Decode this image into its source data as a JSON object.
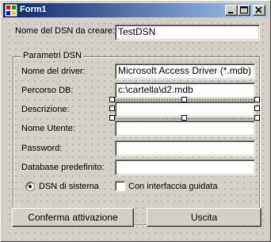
{
  "window": {
    "title": "Form1",
    "minimize_icon": "minimize-icon",
    "maximize_icon": "maximize-icon",
    "close_icon": "close-icon",
    "titlebar_colors": [
      "#0a246a",
      "#a6caf0"
    ]
  },
  "form": {
    "dsn_name_label": "Nome del DSN da creare:",
    "dsn_name_value": "TestDSN",
    "group_title": "Parametri DSN",
    "driver_label": "Nome del driver:",
    "driver_value": "Microsoft Access Driver (*.mdb)",
    "db_path_label": "Percorso DB:",
    "db_path_value": "c:\\cartella\\d2.mdb",
    "description_label": "Descrizione:",
    "description_value": "",
    "username_label": "Nome Utente:",
    "username_value": "",
    "password_label": "Password:",
    "password_value": "",
    "default_db_label": "Database predefinito:",
    "default_db_value": "",
    "system_dsn_label": "DSN di sistema",
    "system_dsn_selected": true,
    "guided_label": "Con interfaccia guidata",
    "guided_checked": false
  },
  "buttons": {
    "confirm_label": "Conferma attivazione",
    "exit_label": "Uscita"
  }
}
